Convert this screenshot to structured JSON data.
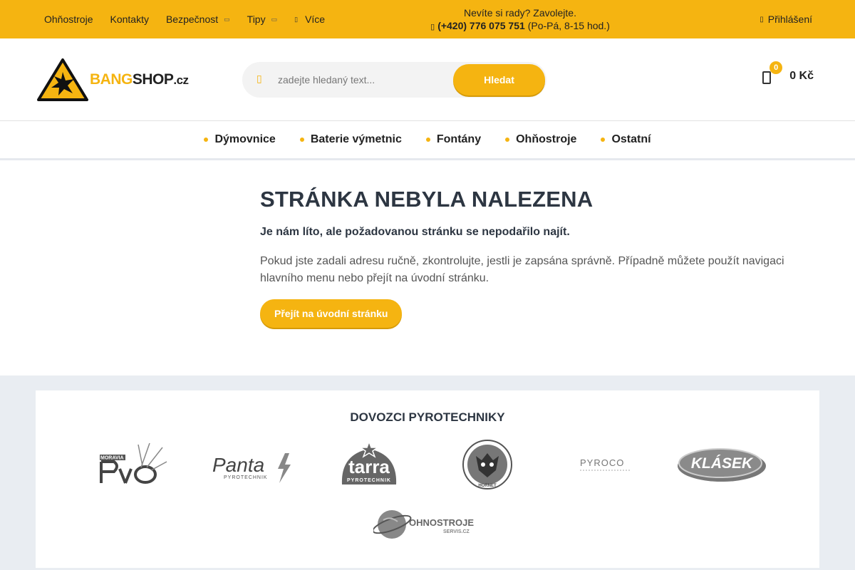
{
  "topbar": {
    "nav": [
      {
        "label": "Ohňostroje"
      },
      {
        "label": "Kontakty"
      },
      {
        "label": "Bezpečnost"
      },
      {
        "label": "Tipy"
      },
      {
        "label": "Více"
      }
    ],
    "call_text": "Nevíte si rady? Zavolejte.",
    "phone": "(+420) 776 075 751",
    "hours": "(Po-Pá, 8-15 hod.)",
    "login": "Přihlášení",
    "color": "#f5b411"
  },
  "header": {
    "logo": {
      "bang": "BANG",
      "shop": "SHOP",
      "cz": ".cz"
    },
    "search": {
      "placeholder": "zadejte hledaný text...",
      "button": "Hledat"
    },
    "cart": {
      "count": "0",
      "total": "0 Kč"
    }
  },
  "categories": [
    {
      "label": "Dýmovnice"
    },
    {
      "label": "Baterie výmetnic"
    },
    {
      "label": "Fontány"
    },
    {
      "label": "Ohňostroje"
    },
    {
      "label": "Ostatní"
    }
  ],
  "error": {
    "title": "STRÁNKA NEBYLA NALEZENA",
    "lead": "Je nám líto, ale požadovanou stránku se nepodařilo najít.",
    "description": "Pokud jste zadali adresu ručně, zkontrolujte, jestli je zapsána správně. Případně můžete použít navigaci hlavního menu nebo přejít na úvodní stránku.",
    "button": "Přejít na úvodní stránku"
  },
  "importers": {
    "title": "DOVOZCI PYROTECHNIKY",
    "brands": [
      {
        "name": "MORAVIA PYRO"
      },
      {
        "name": "Panta PYROTECHNIK"
      },
      {
        "name": "tarra PYROTECHNIK"
      },
      {
        "name": "HORNET"
      },
      {
        "name": "PYROCO"
      },
      {
        "name": "KLÁSEK"
      },
      {
        "name": "OHNOSTROJE SERVIS.CZ"
      }
    ]
  }
}
